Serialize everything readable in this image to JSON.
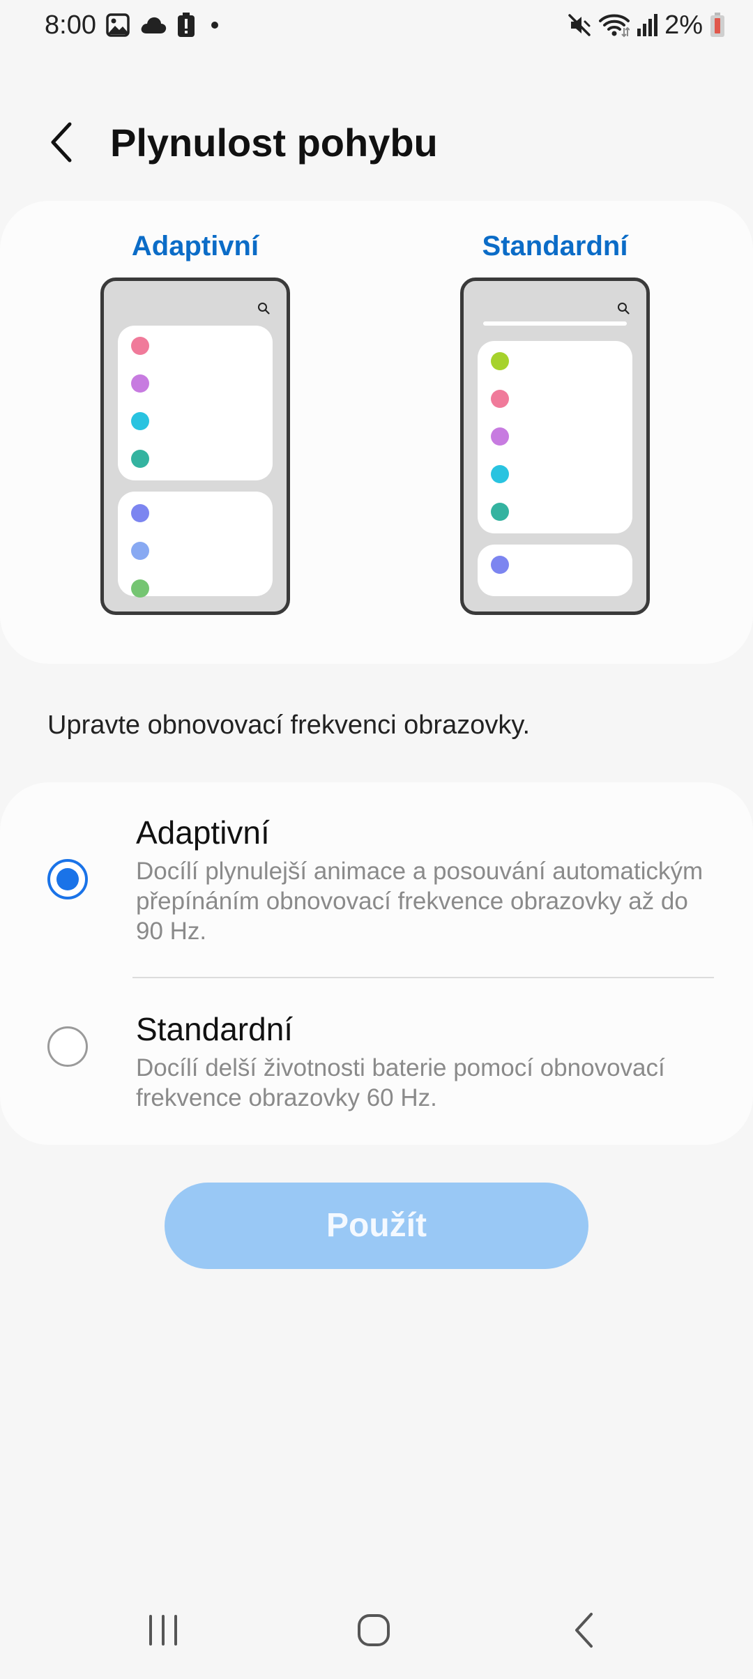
{
  "status_bar": {
    "time": "8:00",
    "left_icons": [
      "image-icon",
      "cloud-icon",
      "battery-alert-icon",
      "dot-icon"
    ],
    "right_icons": [
      "mute-icon",
      "wifi-icon",
      "signal-icon"
    ],
    "battery_percent": "2%",
    "battery_color": "#e0574b"
  },
  "header": {
    "title": "Plynulost pohybu",
    "back_icon": "chevron-left-icon"
  },
  "preview": {
    "accent_color": "#0b6cc7",
    "adaptive": {
      "label": "Adaptivní",
      "dot_colors": [
        "#f07a9a",
        "#c77be0",
        "#29c3e0",
        "#34b3a0",
        "#7c85f0",
        "#88a9f2",
        "#75c572"
      ]
    },
    "standard": {
      "label": "Standardní",
      "dot_colors": [
        "#a6d22c",
        "#f07a9a",
        "#c77be0",
        "#29c3e0",
        "#34b3a0",
        "#7c85f0"
      ]
    }
  },
  "description": "Upravte obnovovací frekvenci obrazovky.",
  "options": [
    {
      "title": "Adaptivní",
      "description": "Docílí plynulejší animace a posouvání automatickým přepínáním obnovovací frekvence obrazovky až do 90 Hz.",
      "selected": true
    },
    {
      "title": "Standardní",
      "description": "Docílí delší životnosti baterie pomocí obnovovací frekvence obrazovky 60 Hz.",
      "selected": false
    }
  ],
  "apply_button": {
    "label": "Použít",
    "enabled": false,
    "color": "#99c8f5"
  },
  "nav_bar": {
    "icons": [
      "recent-apps-icon",
      "home-icon",
      "back-icon"
    ]
  }
}
